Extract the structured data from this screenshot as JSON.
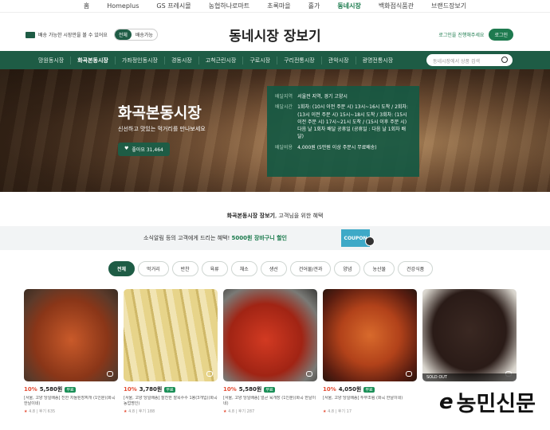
{
  "top_nav": [
    "홈",
    "Homeplus",
    "GS 프레시몰",
    "농협하나로마트",
    "초록마을",
    "홀가",
    "동네시장",
    "백화점식품관",
    "브랜드장보기"
  ],
  "top_nav_active": 6,
  "header": {
    "delivery_text": "배송 가능한 시장만을 볼 수 있어요",
    "toggle_on": "전체",
    "toggle_off": "배송가능",
    "logo": "동네시장 장보기",
    "login_prompt": "로그인을 진행해주세요",
    "login_button": "로그인"
  },
  "categories": [
    "망원동시장",
    "화곡본동시장",
    "가좌정인동시장",
    "경동시장",
    "고척근린시장",
    "구로시장",
    "구리전통시장",
    "관악시장",
    "광명전통시장"
  ],
  "categories_active": 1,
  "search_placeholder": "동네시장에서 상품 검색",
  "hero": {
    "title": "화곡본동시장",
    "subtitle": "신선하고 맛있는 먹거리를 만나보세요",
    "like_label": "좋아요 31,464",
    "info": [
      {
        "k": "배달지역",
        "v": "서울전 지역, 경기 고양시"
      },
      {
        "k": "배달시간",
        "v": "1회차: (10시 이전 주문 시) 13시~16시 도착 / 2회차: (13시 이전 주문 시) 15시~18시 도착 / 3회차: (15시 이전 주문 시) 17시~21시 도착 / (15시 이후 주문 시) 다음 날 1회차 배달 공휴일 (공휴일 : 다음 날 1회차 배달)"
      },
      {
        "k": "배달비용",
        "v": "4,000원 (5만원 이상 주문시 무료배송)"
      }
    ]
  },
  "subhead_bold": "화곡본동시장 장보기",
  "subhead_rest": ", 고객님을 위한 혜택",
  "coupon": {
    "text_pre": "소식알림 등의 고객에게 드리는 혜택!",
    "text_hl": "5000원 장바구니 할인",
    "button": "COUPON"
  },
  "filters": [
    "전체",
    "먹거리",
    "반찬",
    "육류",
    "채소",
    "생선",
    "건어물/견과",
    "양념",
    "농산물",
    "건강식품"
  ],
  "filters_active": 0,
  "products": [
    {
      "disc": "10%",
      "price": "5,580원",
      "tag": "무료",
      "name": "[서울, 고양 당일배송] 진한 차돌된장찌개 (1인분)(화곡 한날이네)",
      "rating": "4.8 | 후기 635",
      "soldout": ""
    },
    {
      "disc": "10%",
      "price": "3,780원",
      "tag": "무료",
      "name": "[서울, 고양 당일배송] 찰진한 찰옥수수 1봉(3개입)(화곡 농업명인)",
      "rating": "4.8 | 후기 188",
      "soldout": ""
    },
    {
      "disc": "10%",
      "price": "5,580원",
      "tag": "무료",
      "name": "[서울, 고양 당일배송] 얼큰 육개장 (1인분)(화곡 한날이네)",
      "rating": "4.8 | 후기 287",
      "soldout": ""
    },
    {
      "disc": "10%",
      "price": "4,050원",
      "tag": "무료",
      "name": "[서울, 고양 당일배송] 두부조림 (화곡 한날이네)",
      "rating": "4.8 | 후기 17",
      "soldout": ""
    },
    {
      "disc": "",
      "price": "",
      "tag": "",
      "name": "",
      "rating": "",
      "soldout": "SOLD OUT"
    }
  ],
  "watermark": {
    "mark": "e",
    "text": "농민신문"
  }
}
